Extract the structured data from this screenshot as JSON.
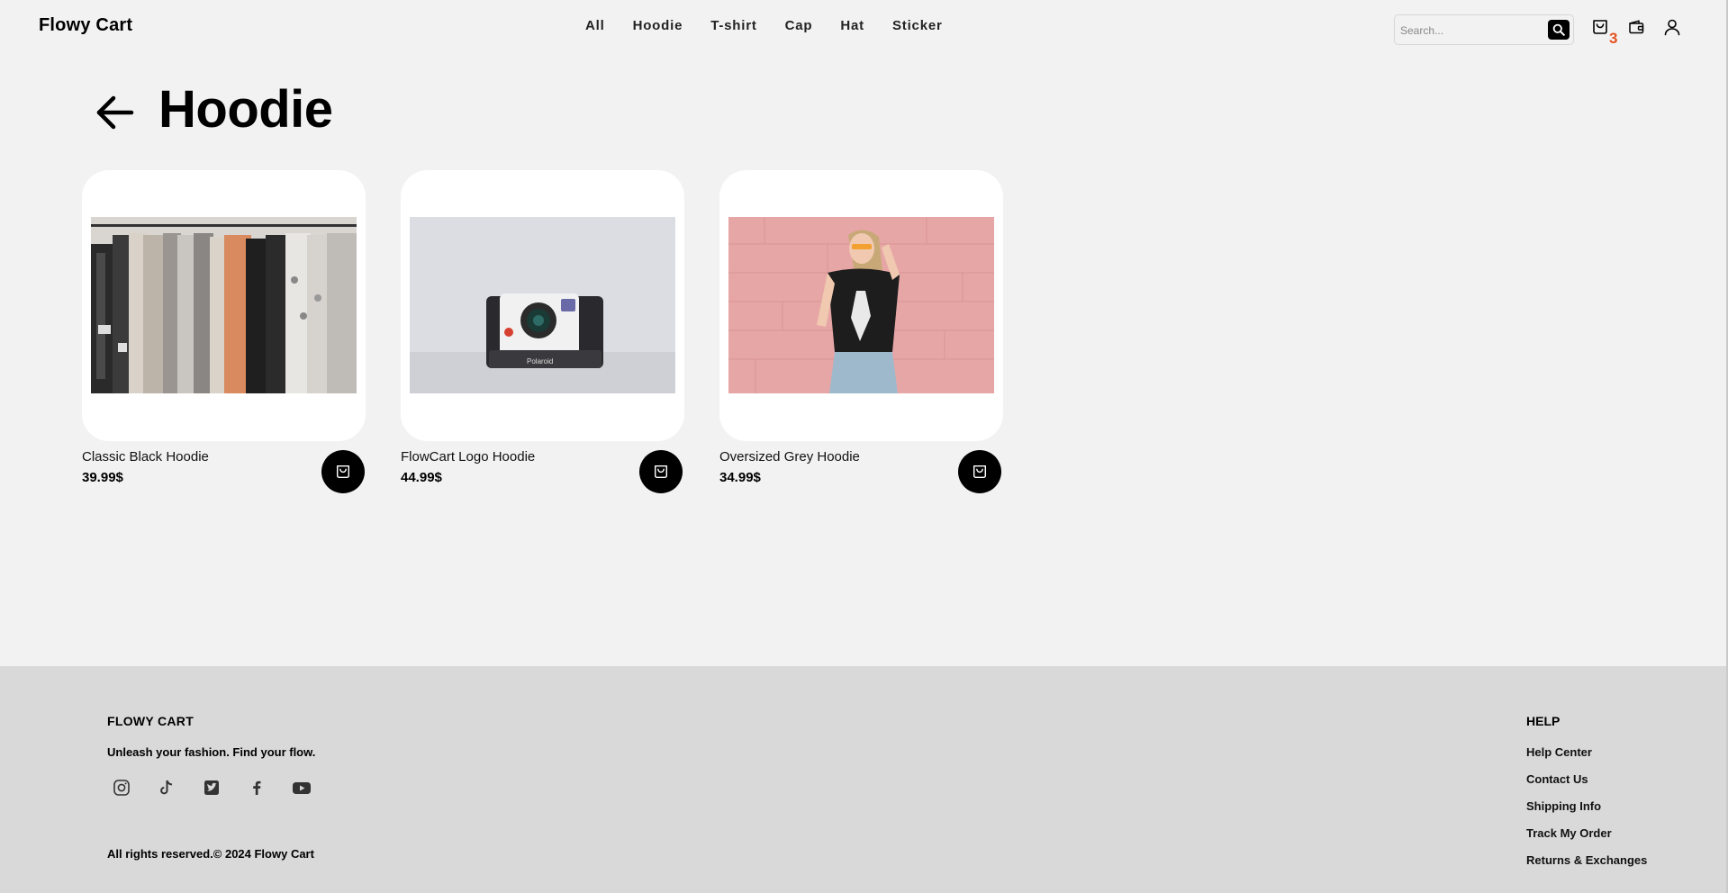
{
  "header": {
    "logo": "Flowy Cart",
    "nav": [
      "All",
      "Hoodie",
      "T-shirt",
      "Cap",
      "Hat",
      "Sticker"
    ],
    "search_placeholder": "Search...",
    "cart_count": "3"
  },
  "page": {
    "title": "Hoodie"
  },
  "products": [
    {
      "name": "Classic Black Hoodie",
      "price": "39.99$",
      "image": "clothing-rack-photo"
    },
    {
      "name": "FlowCart Logo Hoodie",
      "price": "44.99$",
      "image": "instant-camera-photo",
      "camera_text": "Polaroid"
    },
    {
      "name": "Oversized Grey Hoodie",
      "price": "34.99$",
      "image": "woman-pink-wall-photo"
    }
  ],
  "footer": {
    "brand": "FLOWY CART",
    "tagline": "Unleash your fashion. Find your flow.",
    "socials": [
      "instagram-icon",
      "tiktok-icon",
      "twitter-icon",
      "facebook-icon",
      "youtube-icon"
    ],
    "copyright": "All rights reserved.© 2024 Flowy Cart",
    "help_title": "HELP",
    "help_links": [
      "Help Center",
      "Contact Us",
      "Shipping Info",
      "Track My Order",
      "Returns & Exchanges"
    ]
  },
  "colors": {
    "background": "#f2f2f2",
    "footer": "#d9d9d9",
    "accent": "#e5531f",
    "button": "#000000"
  }
}
